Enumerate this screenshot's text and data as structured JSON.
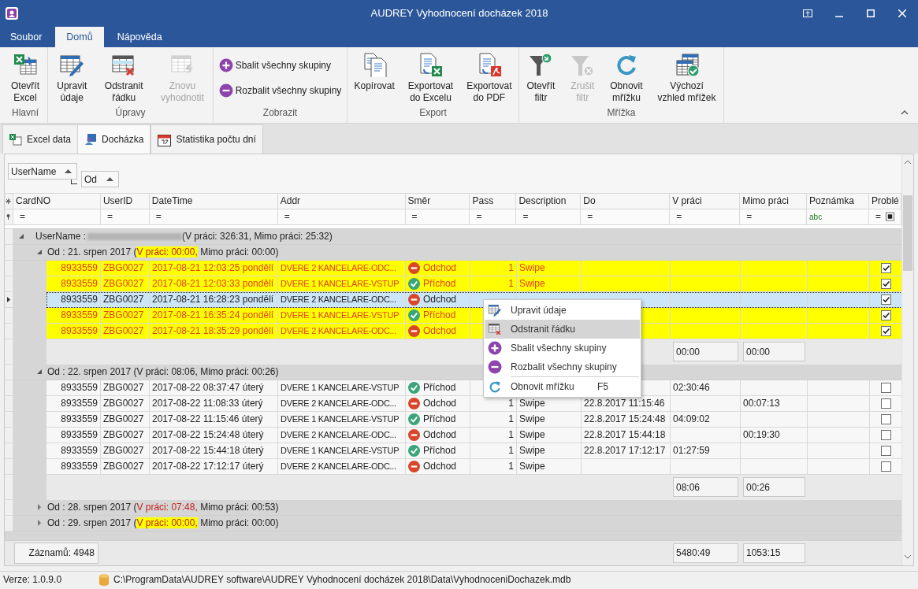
{
  "window": {
    "title": "AUDREY Vyhodnocení docházek 2018"
  },
  "menu_tabs": [
    {
      "label": "Soubor",
      "selected": false
    },
    {
      "label": "Domů",
      "selected": true
    },
    {
      "label": "Nápověda",
      "selected": false
    }
  ],
  "ribbon": {
    "groups": [
      {
        "label": "Hlavní",
        "items": [
          {
            "kind": "large",
            "label": "Otevřít\nExcel",
            "disabled": false
          }
        ]
      },
      {
        "label": "Úpravy",
        "items": [
          {
            "kind": "large",
            "label": "Upravit\núdaje",
            "disabled": false
          },
          {
            "kind": "large",
            "label": "Odstranit\nřádku",
            "disabled": false
          },
          {
            "kind": "large",
            "label": "Znovu\nvyhodnotit",
            "disabled": true
          }
        ]
      },
      {
        "label": "Zobrazit",
        "items": [
          {
            "kind": "small",
            "label": "Sbalit všechny skupiny",
            "disabled": false
          },
          {
            "kind": "small",
            "label": "Rozbalit všechny skupiny",
            "disabled": false
          }
        ]
      },
      {
        "label": "Export",
        "items": [
          {
            "kind": "large",
            "label": "Kopírovat",
            "disabled": false
          },
          {
            "kind": "large",
            "label": "Exportovat\ndo Excelu",
            "disabled": false
          },
          {
            "kind": "large",
            "label": "Exportovat\ndo PDF",
            "disabled": false
          }
        ]
      },
      {
        "label": "Mřížka",
        "items": [
          {
            "kind": "large",
            "label": "Otevřít\nfiltr",
            "disabled": false
          },
          {
            "kind": "large",
            "label": "Zrušit\nfiltr",
            "disabled": true
          },
          {
            "kind": "large",
            "label": "Obnovit\nmřížku",
            "disabled": false
          },
          {
            "kind": "large",
            "label": "Výchozí\nvzhled mřížek",
            "disabled": false
          }
        ]
      }
    ]
  },
  "view_tabs": [
    {
      "label": "Excel data",
      "selected": false
    },
    {
      "label": "Docházka",
      "selected": true
    },
    {
      "label": "Statistika počtu dní",
      "selected": false
    }
  ],
  "group_panel": [
    {
      "label": "UserName"
    },
    {
      "label": "Od"
    }
  ],
  "grid": {
    "columns": [
      "CardNO",
      "UserID",
      "DateTime",
      "Addr",
      "Směr",
      "Pass",
      "Description",
      "Do",
      "V práci",
      "Mimo práci",
      "Poznámka",
      "Problé"
    ],
    "filter_row": [
      "=",
      "=",
      "=",
      "=",
      "=",
      "=",
      "=",
      "=",
      "=",
      "=",
      "abc",
      "="
    ],
    "user_groups": [
      {
        "label": "UserName :",
        "redacted": true,
        "summary": "(V práci: 326:31, Mimo práci: 25:32)",
        "expanded": true,
        "children": [
          {
            "prefix": "Od : 21. srpen 2017 (",
            "in_work": "V práci: 00:00,",
            "rest": " Mimo práci: 00:00)",
            "highlight": true,
            "red_text": true,
            "expanded": true,
            "rows": [
              {
                "highlight": true,
                "selected": false,
                "card": "8933559",
                "user": "ZBG0027",
                "datetime": "2017-08-21 12:03:25 pondělí",
                "addr": "DVERE 2 KANCELARE-ODC...",
                "direction": {
                  "kind": "out",
                  "label": "Odchod"
                },
                "pass": "1",
                "desc": "Swipe",
                "problem": true
              },
              {
                "highlight": true,
                "selected": false,
                "card": "8933559",
                "user": "ZBG0027",
                "datetime": "2017-08-21 12:03:33 pondělí",
                "addr": "DVERE 1 KANCELARE-VSTUP",
                "direction": {
                  "kind": "in",
                  "label": "Příchod"
                },
                "pass": "1",
                "desc": "Swipe",
                "problem": true
              },
              {
                "selected": true,
                "card": "8933559",
                "user": "ZBG0027",
                "datetime": "2017-08-21 16:28:23 pondělí",
                "addr": "DVERE 2 KANCELARE-ODC...",
                "direction": {
                  "kind": "out",
                  "label": "Odchod"
                },
                "problem": true
              },
              {
                "highlight": true,
                "selected": false,
                "card": "8933559",
                "user": "ZBG0027",
                "datetime": "2017-08-21 16:35:24 pondělí",
                "addr": "DVERE 1 KANCELARE-VSTUP",
                "direction": {
                  "kind": "in",
                  "label": "Příchod"
                },
                "problem": true
              },
              {
                "highlight": true,
                "selected": false,
                "card": "8933559",
                "user": "ZBG0027",
                "datetime": "2017-08-21 18:35:29 pondělí",
                "addr": "DVERE 2 KANCELARE-ODC...",
                "direction": {
                  "kind": "out",
                  "label": "Odchod"
                },
                "problem": true
              }
            ],
            "footer": {
              "in_work": "00:00",
              "off_work": "00:00"
            }
          },
          {
            "prefix": "Od : 22. srpen 2017 (",
            "in_work": "V práci: 08:06,",
            "rest": " Mimo práci: 00:26)",
            "highlight": false,
            "red_text": false,
            "expanded": true,
            "rows": [
              {
                "highlight": false,
                "selected": false,
                "card": "8933559",
                "user": "ZBG0027",
                "datetime": "2017-08-22 08:37:47 úterý",
                "addr": "DVERE 1 KANCELARE-VSTUP",
                "direction": {
                  "kind": "in",
                  "label": "Příchod"
                },
                "in_work": "02:30:46",
                "problem": false
              },
              {
                "highlight": false,
                "selected": false,
                "card": "8933559",
                "user": "ZBG0027",
                "datetime": "2017-08-22 11:08:33 úterý",
                "addr": "DVERE 2 KANCELARE-ODC...",
                "direction": {
                  "kind": "out",
                  "label": "Odchod"
                },
                "pass": "1",
                "desc": "Swipe",
                "do": "22.8.2017 11:15:46",
                "off_work": "00:07:13",
                "problem": false
              },
              {
                "highlight": false,
                "selected": false,
                "card": "8933559",
                "user": "ZBG0027",
                "datetime": "2017-08-22 11:15:46 úterý",
                "addr": "DVERE 1 KANCELARE-VSTUP",
                "direction": {
                  "kind": "in",
                  "label": "Příchod"
                },
                "pass": "1",
                "desc": "Swipe",
                "do": "22.8.2017 15:24:48",
                "in_work": "04:09:02",
                "problem": false
              },
              {
                "highlight": false,
                "selected": false,
                "card": "8933559",
                "user": "ZBG0027",
                "datetime": "2017-08-22 15:24:48 úterý",
                "addr": "DVERE 2 KANCELARE-ODC...",
                "direction": {
                  "kind": "out",
                  "label": "Odchod"
                },
                "pass": "1",
                "desc": "Swipe",
                "do": "22.8.2017 15:44:18",
                "off_work": "00:19:30",
                "problem": false
              },
              {
                "highlight": false,
                "selected": false,
                "card": "8933559",
                "user": "ZBG0027",
                "datetime": "2017-08-22 15:44:18 úterý",
                "addr": "DVERE 1 KANCELARE-VSTUP",
                "direction": {
                  "kind": "in",
                  "label": "Příchod"
                },
                "pass": "1",
                "desc": "Swipe",
                "do": "22.8.2017 17:12:17",
                "in_work": "01:27:59",
                "problem": false
              },
              {
                "highlight": false,
                "selected": false,
                "card": "8933559",
                "user": "ZBG0027",
                "datetime": "2017-08-22 17:12:17 úterý",
                "addr": "DVERE 2 KANCELARE-ODC...",
                "direction": {
                  "kind": "out",
                  "label": "Odchod"
                },
                "pass": "1",
                "desc": "Swipe",
                "problem": false
              }
            ],
            "footer": {
              "in_work": "08:06",
              "off_work": "00:26"
            }
          },
          {
            "prefix": "Od : 28. srpen 2017 (",
            "in_work": "V práci: 07:48,",
            "rest": " Mimo práci: 00:53)",
            "highlight": false,
            "red_text": true,
            "expanded": false
          },
          {
            "prefix": "Od : 29. srpen 2017 (",
            "in_work": "V práci: 00:00,",
            "rest": " Mimo práci: 00:00)",
            "highlight": true,
            "red_text": true,
            "expanded": false
          }
        ]
      }
    ],
    "footer": {
      "records": "Záznamů: 4948",
      "in_work": "5480:49",
      "off_work": "1053:15"
    }
  },
  "context_menu": {
    "sections": [
      [
        {
          "label": "Upravit údaje",
          "selected": false
        },
        {
          "label": "Odstranit řádku",
          "selected": true
        },
        {
          "label": "Sbalit všechny skupiny",
          "selected": false
        },
        {
          "label": "Rozbalit všechny skupiny",
          "selected": false
        }
      ],
      [
        {
          "label": "Obnovit mřížku",
          "shortcut": "F5",
          "selected": false
        }
      ]
    ]
  },
  "status_bar": {
    "version": "Verze: 1.0.9.0",
    "path": "C:\\ProgramData\\AUDREY software\\AUDREY Vyhodnocení docházek 2018\\Data\\VyhodnoceniDochazek.mdb"
  }
}
